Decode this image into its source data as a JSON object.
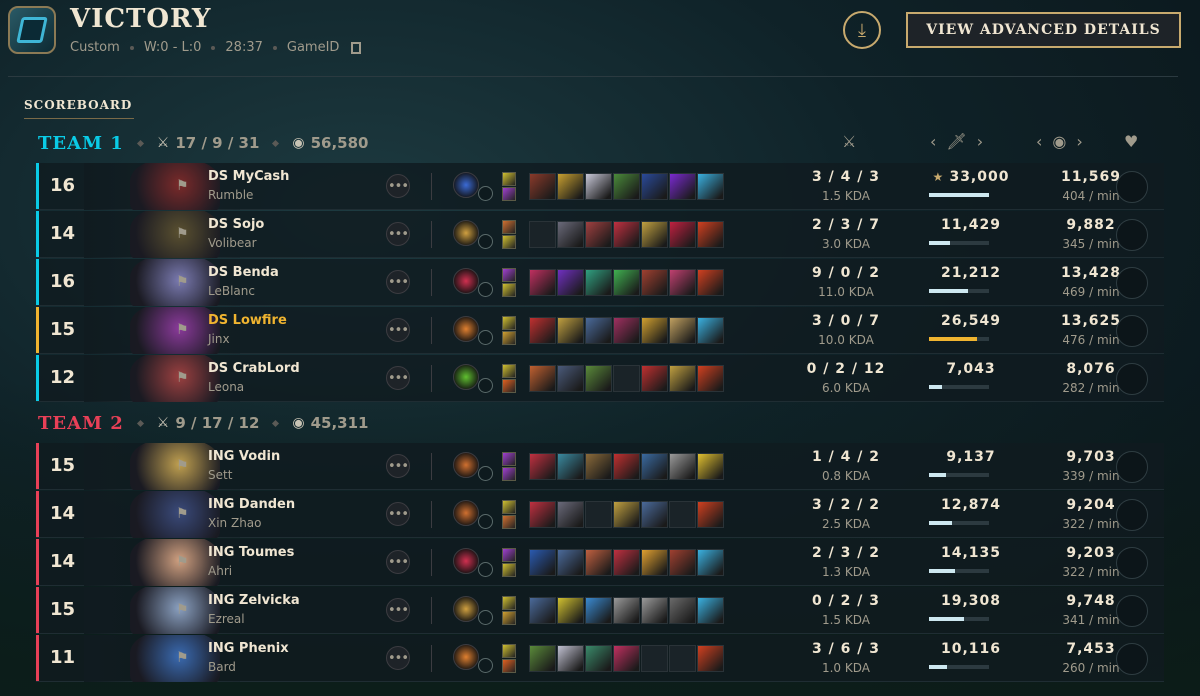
{
  "header": {
    "title": "VICTORY",
    "mode": "Custom",
    "record": "W:0 - L:0",
    "duration": "28:37",
    "gameid_label": "GameID",
    "advanced_button": "VIEW ADVANCED DETAILS",
    "download_icon": "download-icon",
    "copy_icon": "copy-icon"
  },
  "scoreboard_label": "SCOREBOARD",
  "columns": {
    "kda_icon": "crossed-swords-icon",
    "damage_icon": "sword-icon",
    "gold_icon": "gold-coins-icon",
    "ward_icon": "heart-icon",
    "prev_arrow": "‹",
    "next_arrow": "›"
  },
  "team1": {
    "name": "TEAM 1",
    "color": "#0acbe6",
    "kda": "17 / 9 / 31",
    "gold": "56,580",
    "players": [
      {
        "level": "16",
        "name": "DS MyCash",
        "champion": "Rumble",
        "kda": "3 / 4 / 3",
        "kda_ratio": "1.5 KDA",
        "damage": "33,000",
        "damage_pct": 1.0,
        "top_damage": true,
        "gold": "11,569",
        "gpm": "404 / min",
        "highlight": false,
        "face": "#7a2a2a",
        "keystone": "#3b6bd6",
        "items": [
          "#8a3a2a",
          "#c8a030",
          "#c8c8d8",
          "#4a8a3a",
          "#2a4a9a",
          "#7a2ad0",
          "#3ab0e0"
        ],
        "spells": [
          "#d0c030",
          "#a040d0"
        ]
      },
      {
        "level": "14",
        "name": "DS Sojo",
        "champion": "Volibear",
        "kda": "2 / 3 / 7",
        "kda_ratio": "3.0 KDA",
        "damage": "11,429",
        "damage_pct": 0.346,
        "top_damage": false,
        "gold": "9,882",
        "gpm": "345 / min",
        "highlight": false,
        "face": "#5a5030",
        "keystone": "#d0a040",
        "items": [
          "",
          "#6a6a7a",
          "#a04040",
          "#c03040",
          "#c0a040",
          "#c02040",
          "#d04020"
        ],
        "spells": [
          "#d07030",
          "#d0c030"
        ]
      },
      {
        "level": "16",
        "name": "DS Benda",
        "champion": "LeBlanc",
        "kda": "9 / 0 / 2",
        "kda_ratio": "11.0 KDA",
        "damage": "21,212",
        "damage_pct": 0.643,
        "top_damage": false,
        "gold": "13,428",
        "gpm": "469 / min",
        "highlight": false,
        "face": "#7a7ab0",
        "keystone": "#d03050",
        "items": [
          "#c03060",
          "#7030c0",
          "#30a080",
          "#40b050",
          "#a04030",
          "#c04070",
          "#d04020"
        ],
        "spells": [
          "#a040d0",
          "#d0c030"
        ]
      },
      {
        "level": "15",
        "name": "DS Lowfire",
        "champion": "Jinx",
        "kda": "3 / 0 / 7",
        "kda_ratio": "10.0 KDA",
        "damage": "26,549",
        "damage_pct": 0.805,
        "top_damage": false,
        "gold": "13,625",
        "gpm": "476 / min",
        "highlight": true,
        "face": "#8a3a9a",
        "keystone": "#e08030",
        "items": [
          "#c03030",
          "#c0a040",
          "#4a6a9a",
          "#a03060",
          "#d0a030",
          "#c0a060",
          "#3ab0e0"
        ],
        "spells": [
          "#d0c030",
          "#d0a030"
        ]
      },
      {
        "level": "12",
        "name": "DS CrabLord",
        "champion": "Leona",
        "kda": "0 / 2 / 12",
        "kda_ratio": "6.0 KDA",
        "damage": "7,043",
        "damage_pct": 0.213,
        "top_damage": false,
        "gold": "8,076",
        "gpm": "282 / min",
        "highlight": false,
        "face": "#9a4040",
        "keystone": "#60c030",
        "items": [
          "#c06030",
          "#4a5a7a",
          "#5a8a3a",
          "",
          "#c03030",
          "#c0a040",
          "#d04020"
        ],
        "spells": [
          "#d0c030",
          "#e06020"
        ]
      }
    ]
  },
  "team2": {
    "name": "TEAM 2",
    "color": "#e84057",
    "kda": "9 / 17 / 12",
    "gold": "45,311",
    "players": [
      {
        "level": "15",
        "name": "ING Vodin",
        "champion": "Sett",
        "kda": "1 / 4 / 2",
        "kda_ratio": "0.8 KDA",
        "damage": "9,137",
        "damage_pct": 0.277,
        "top_damage": false,
        "gold": "9,703",
        "gpm": "339 / min",
        "highlight": false,
        "face": "#c0a050",
        "keystone": "#d07030",
        "items": [
          "#c03040",
          "#3a8aa0",
          "#8a6a3a",
          "#c03030",
          "#3a6aa0",
          "#9a9a9a",
          "#e0c030"
        ],
        "spells": [
          "#a040d0",
          "#a040d0"
        ]
      },
      {
        "level": "14",
        "name": "ING Danden",
        "champion": "Xin Zhao",
        "kda": "3 / 2 / 2",
        "kda_ratio": "2.5 KDA",
        "damage": "12,874",
        "damage_pct": 0.39,
        "top_damage": false,
        "gold": "9,204",
        "gpm": "322 / min",
        "highlight": false,
        "face": "#3a4a7a",
        "keystone": "#d07030",
        "items": [
          "#c03040",
          "#6a6a7a",
          "",
          "#c0a040",
          "#4a6a9a",
          "",
          "#d04020"
        ],
        "spells": [
          "#d0c030",
          "#d07030"
        ]
      },
      {
        "level": "14",
        "name": "ING Toumes",
        "champion": "Ahri",
        "kda": "2 / 3 / 2",
        "kda_ratio": "1.3 KDA",
        "damage": "14,135",
        "damage_pct": 0.428,
        "top_damage": false,
        "gold": "9,203",
        "gpm": "322 / min",
        "highlight": false,
        "face": "#d0a080",
        "keystone": "#d03050",
        "items": [
          "#2a5ab0",
          "#4a6a9a",
          "#c06040",
          "#c03040",
          "#e0a030",
          "#a04030",
          "#3ab0e0"
        ],
        "spells": [
          "#a040d0",
          "#d0c030"
        ]
      },
      {
        "level": "15",
        "name": "ING Zelvicka",
        "champion": "Ezreal",
        "kda": "0 / 2 / 3",
        "kda_ratio": "1.5 KDA",
        "damage": "19,308",
        "damage_pct": 0.585,
        "top_damage": false,
        "gold": "9,748",
        "gpm": "341 / min",
        "highlight": false,
        "face": "#8aa0c0",
        "keystone": "#d0a040",
        "items": [
          "#4a6a9a",
          "#d0c030",
          "#3a8ad0",
          "#9a9a9a",
          "#9a9a9a",
          "#6a6a6a",
          "#3ab0e0"
        ],
        "spells": [
          "#d0c030",
          "#d0a030"
        ]
      },
      {
        "level": "11",
        "name": "ING Phenix",
        "champion": "Bard",
        "kda": "3 / 6 / 3",
        "kda_ratio": "1.0 KDA",
        "damage": "10,116",
        "damage_pct": 0.307,
        "top_damage": false,
        "gold": "7,453",
        "gpm": "260 / min",
        "highlight": false,
        "face": "#3a6ab0",
        "keystone": "#e08030",
        "items": [
          "#5a8a3a",
          "#c0c0d0",
          "#3a8a6a",
          "#c03060",
          "",
          "",
          "#d04020"
        ],
        "spells": [
          "#d0c030",
          "#e06020"
        ]
      }
    ]
  }
}
